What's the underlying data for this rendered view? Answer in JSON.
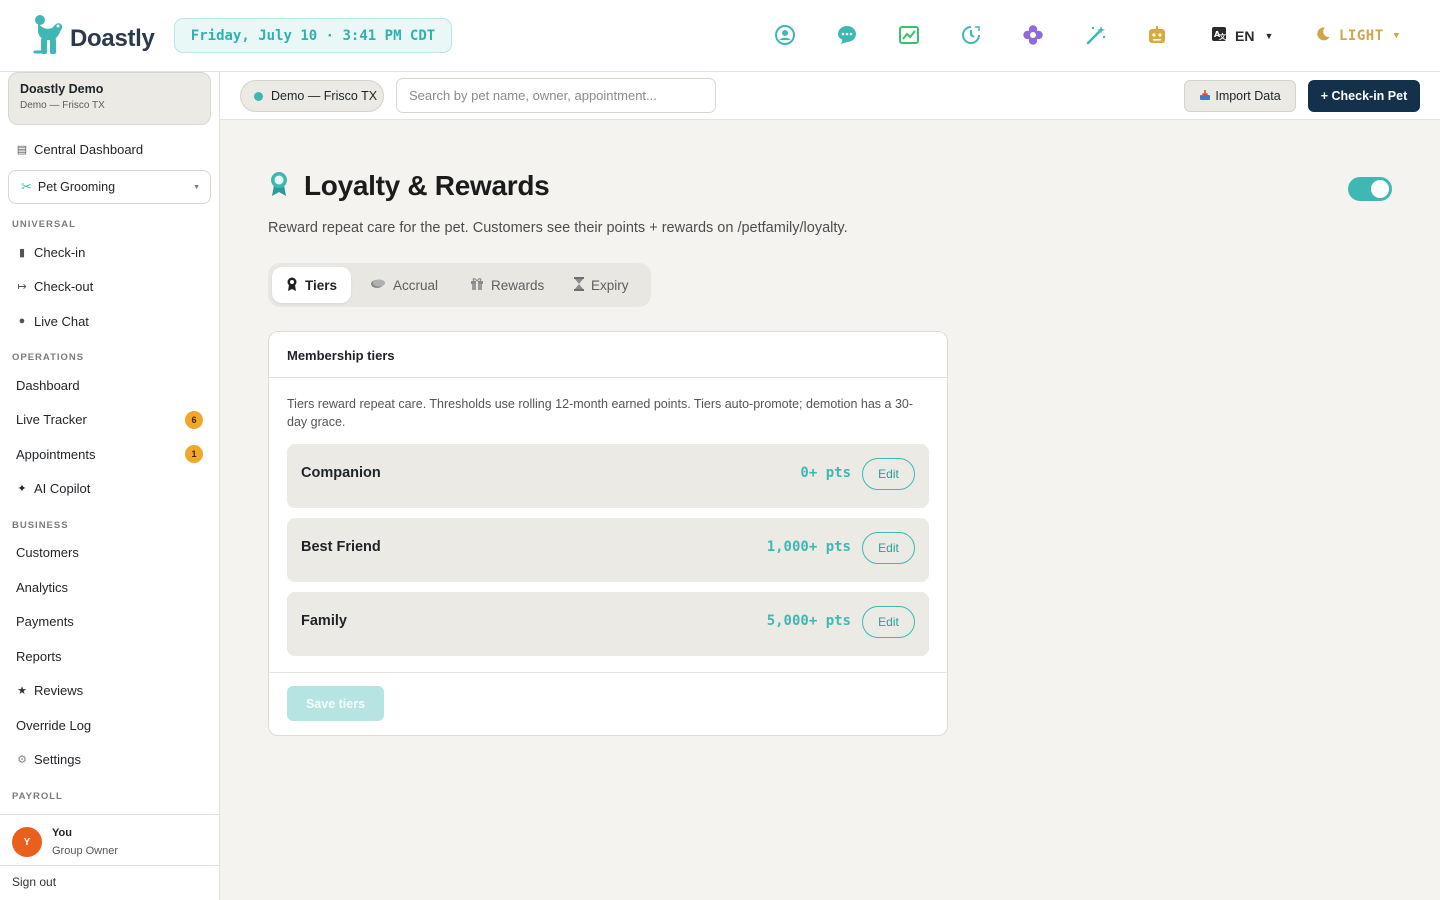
{
  "app": {
    "name": "Doastly"
  },
  "header": {
    "datetime": "Friday, July 10 · 3:41 PM CDT",
    "language": "EN",
    "theme": "LIGHT"
  },
  "sidebar": {
    "org_name": "Doastly Demo",
    "org_location": "Demo — Frisco TX",
    "central_dashboard": "Central Dashboard",
    "module": "Pet Grooming",
    "sections": {
      "universal": "UNIVERSAL",
      "operations": "OPERATIONS",
      "business": "BUSINESS",
      "payroll": "PAYROLL"
    },
    "universal_items": [
      "Check-in",
      "Check-out",
      "Live Chat"
    ],
    "operations_items": [
      "Dashboard",
      "Live Tracker",
      "Appointments",
      "AI Copilot"
    ],
    "badges": {
      "live_tracker": "6",
      "appointments": "1"
    },
    "business_items": [
      "Customers",
      "Analytics",
      "Payments",
      "Reports",
      "Reviews",
      "Override Log",
      "Settings"
    ],
    "user": {
      "initial": "Y",
      "name": "You",
      "role": "Group Owner"
    },
    "sign_out": "Sign out"
  },
  "subheader": {
    "location": "Demo — Frisco TX",
    "search_placeholder": "Search by pet name, owner, appointment...",
    "import_label": "Import Data",
    "checkin_label": "+ Check-in Pet"
  },
  "page": {
    "title": "Loyalty & Rewards",
    "description": "Reward repeat care for the pet. Customers see their points + rewards on /petfamily/loyalty.",
    "enabled": true,
    "tabs": [
      "Tiers",
      "Accrual",
      "Rewards",
      "Expiry"
    ],
    "active_tab": "Tiers"
  },
  "tiers_card": {
    "heading": "Membership tiers",
    "description": "Tiers reward repeat care. Thresholds use rolling 12-month earned points. Tiers auto-promote; demotion has a 30-day grace.",
    "tiers": [
      {
        "name": "Companion",
        "points": "0+ pts",
        "edit_label": "Edit"
      },
      {
        "name": "Best Friend",
        "points": "1,000+ pts",
        "edit_label": "Edit"
      },
      {
        "name": "Family",
        "points": "5,000+ pts",
        "edit_label": "Edit"
      }
    ],
    "save_label": "Save tiers"
  },
  "colors": {
    "accent": "#3fb8b4",
    "primary_button": "#14304a",
    "badge": "#f0a72a",
    "avatar": "#e8601c",
    "theme_text": "#cfa64a"
  },
  "icons": [
    "dog-logo-icon",
    "support-icon",
    "chat-icon",
    "chart-icon",
    "clock-icon",
    "flower-icon",
    "magic-wand-icon",
    "robot-icon",
    "translate-icon",
    "moon-icon"
  ]
}
